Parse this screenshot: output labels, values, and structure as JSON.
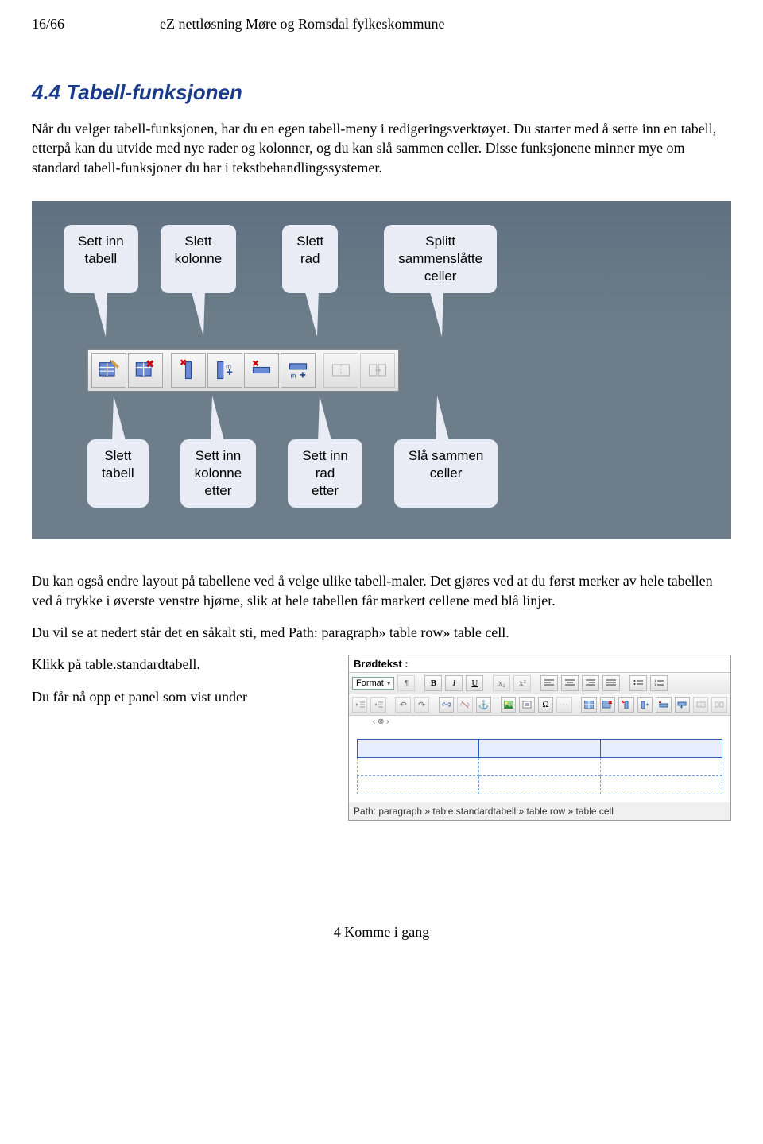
{
  "header": {
    "page_indicator": "16/66",
    "doc_title": "eZ nettløsning Møre og Romsdal fylkeskommune"
  },
  "section": {
    "number_title": "4.4 Tabell-funksjonen",
    "para1": "Når du velger tabell-funksjonen, har du en egen tabell-meny i redigeringsverktøyet. Du starter med å sette inn en tabell, etterpå kan du utvide med nye rader og kolonner, og du kan slå sammen celler. Disse funksjonene minner mye om standard tabell-funksjoner du har i tekstbehandlingssystemer.",
    "para2": "Du kan også endre layout på tabellene ved å velge ulike tabell-maler. Det gjøres ved at du først merker av hele tabellen ved å trykke i øverste venstre hjørne, slik at hele tabellen får markert cellene med blå linjer.",
    "para3": "Du vil se at nedert står det en såkalt sti, med Path: paragraph» table row» table cell.",
    "para4": "Klikk på table.standardtabell.",
    "para5": "Du får nå opp et panel som vist under"
  },
  "diagram": {
    "top": {
      "insert_table": "Sett inn\ntabell",
      "delete_column": "Slett\nkolonne",
      "delete_row": "Slett\nrad",
      "split_merged": "Splitt\nsammenslåtte\nceller"
    },
    "bottom": {
      "delete_table": "Slett\ntabell",
      "insert_column_after": "Sett inn\nkolonne\netter",
      "insert_row_after": "Sett inn\nrad\netter",
      "merge_cells": "Slå sammen\nceller"
    },
    "icons": [
      "insert-table-icon",
      "delete-table-icon",
      "delete-column-icon",
      "insert-column-after-icon",
      "delete-row-icon",
      "insert-row-after-icon",
      "split-cells-icon",
      "merge-cells-icon"
    ]
  },
  "editor": {
    "title": "Brødtekst :",
    "format_label": "Format",
    "path_text": "Path:  paragraph » table.standardtabell » table row » table cell",
    "handle_text": "‹ ⊗ ›"
  },
  "footer": {
    "chapter": "4 Komme i gang"
  }
}
